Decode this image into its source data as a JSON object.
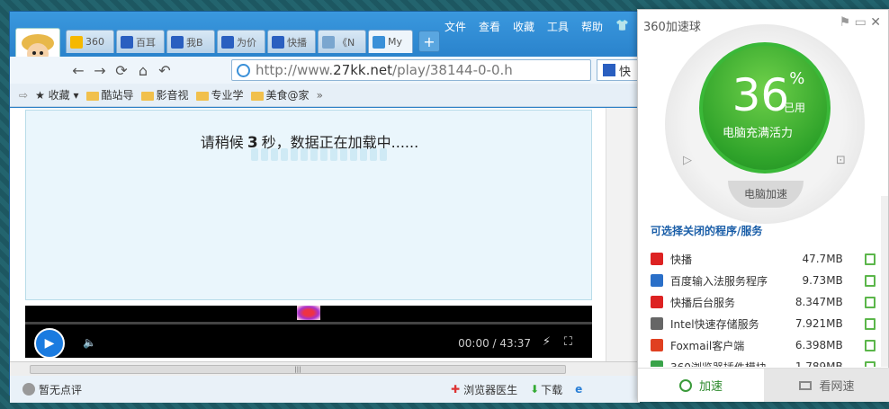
{
  "browser": {
    "menu": [
      "文件",
      "查看",
      "收藏",
      "工具",
      "帮助"
    ],
    "tabs": [
      {
        "label": "360",
        "color": "#f5b800"
      },
      {
        "label": "百耳",
        "color": "#2a5fc0"
      },
      {
        "label": "我B",
        "color": "#2a5fc0"
      },
      {
        "label": "为价",
        "color": "#2a5fc0"
      },
      {
        "label": "快播",
        "color": "#2a5fc0"
      },
      {
        "label": "《N",
        "color": "#7aa6cf"
      },
      {
        "label": "My",
        "color": "#3a90d8"
      }
    ],
    "new_tab": "+",
    "url_prefix": "http://www.",
    "url_domain": "27kk.net",
    "url_path": "/play/38144-0-0.h",
    "search_text": "快",
    "favorites": [
      "收藏",
      "酷站导",
      "影音视",
      "专业学",
      "美食@家"
    ],
    "loading_prefix": "请稍候",
    "loading_num": "3",
    "loading_suffix": "秒，数据正在加载中......",
    "player_time": "00:00 / 43:37",
    "hscroll_grip": "|||",
    "status_left": "暂无点评",
    "status_doctor": "浏览器医生",
    "status_download": "下载"
  },
  "panel": {
    "title": "360加速球",
    "percent": "36",
    "percent_sign": "%",
    "used": "已用",
    "fill_text": "电脑充满活力",
    "speed_badge": "电脑加速",
    "section": "可选择关闭的程序/服务",
    "items": [
      {
        "name": "快播",
        "size": "47.7MB",
        "color": "#d22"
      },
      {
        "name": "百度输入法服务程序",
        "size": "9.73MB",
        "color": "#2a6fc8"
      },
      {
        "name": "快播后台服务",
        "size": "8.347MB",
        "color": "#d22"
      },
      {
        "name": "Intel快速存储服务",
        "size": "7.921MB",
        "color": "#666"
      },
      {
        "name": "Foxmail客户端",
        "size": "6.398MB",
        "color": "#e04020"
      },
      {
        "name": "360浏览器插件模块",
        "size": "1.789MB",
        "color": "#3aa34a"
      }
    ],
    "btn_speed": "加速",
    "btn_net": "看网速"
  }
}
